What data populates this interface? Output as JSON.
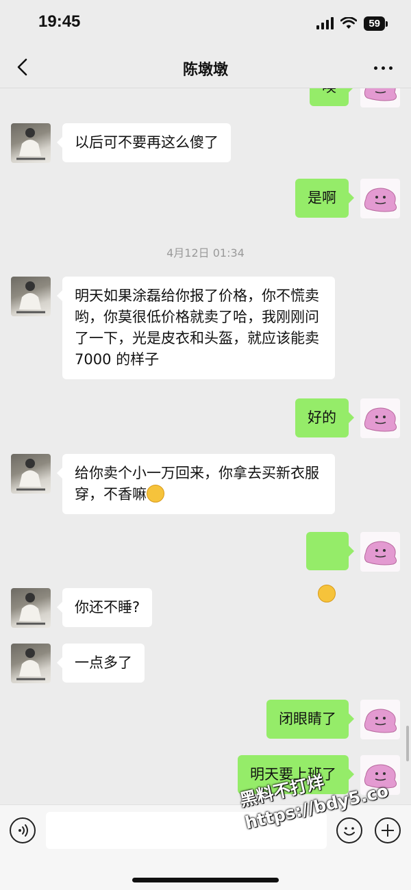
{
  "status_bar": {
    "time": "19:45",
    "battery": "59"
  },
  "nav": {
    "title": "陈墩墩"
  },
  "messages": [
    {
      "side": "right",
      "text": "唉"
    },
    {
      "side": "left",
      "text": "以后可不要再这么傻了"
    },
    {
      "side": "right",
      "text": "是啊"
    },
    {
      "type": "time",
      "text": "4月12日 01:34"
    },
    {
      "side": "left",
      "text": "明天如果涂磊给你报了价格，你不慌卖哟，你莫很低价格就卖了哈，我刚刚问了一下，光是皮衣和头盔，就应该能卖 7000 的样子"
    },
    {
      "side": "right",
      "text": "好的"
    },
    {
      "side": "left",
      "text": "给你卖个小一万回来，你拿去买新衣服穿，不香嘛"
    },
    {
      "side": "right",
      "text": ""
    },
    {
      "side": "left",
      "text": "你还不睡?"
    },
    {
      "side": "left",
      "text": "一点多了"
    },
    {
      "side": "right",
      "text": "闭眼睛了"
    },
    {
      "side": "right",
      "text": "明天要上班了"
    }
  ],
  "icons": {
    "back": "chevron-left-icon",
    "more": "more-dots-icon",
    "voice": "voice-icon",
    "emoji": "smiley-icon",
    "plus": "plus-icon"
  },
  "colors": {
    "sent_bubble": "#95ec69",
    "received_bubble": "#ffffff",
    "background": "#ececec"
  },
  "watermark": {
    "line1": "黑料不打烊",
    "line2": "https://bdy5.co"
  }
}
